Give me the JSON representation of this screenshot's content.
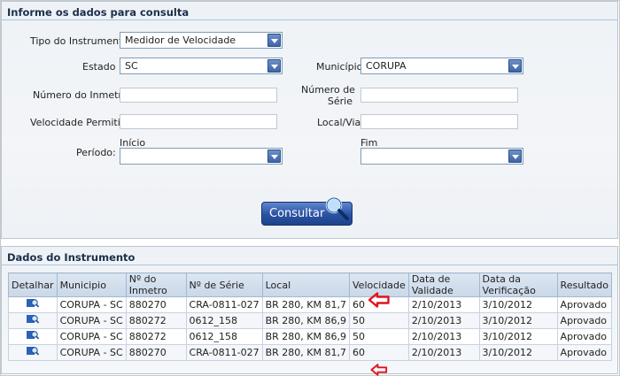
{
  "form": {
    "title": "Informe os dados para consulta",
    "tipo_label": "Tipo do Instrumento",
    "tipo_value": "Medidor de Velocidade",
    "estado_label": "Estado",
    "estado_value": "SC",
    "municipio_label": "Município",
    "municipio_value": "CORUPA",
    "inmetro_label": "Número do Inmetro",
    "inmetro_value": "",
    "serie_label_1": "Número de",
    "serie_label_2": "Série",
    "serie_value": "",
    "velocidade_label": "Velocidade Permitida",
    "velocidade_value": "",
    "local_label": "Local/Via",
    "local_value": "",
    "periodo_label": "Período:",
    "inicio_label": "Início",
    "fim_label": "Fim",
    "inicio_value": "",
    "fim_value": "",
    "consultar_label": "Consultar"
  },
  "results": {
    "title": "Dados do Instrumento",
    "headers": [
      "Detalhar",
      "Municipio",
      "Nº do Inmetro",
      "Nº de Série",
      "Local",
      "Velocidade",
      "Data de Validade",
      "Data da Verificação",
      "Resultado"
    ],
    "rows": [
      [
        "",
        "CORUPA - SC",
        "880270",
        "CRA-0811-027",
        "BR 280, KM 81,7",
        "60",
        "2/10/2013",
        "3/10/2012",
        "Aprovado"
      ],
      [
        "",
        "CORUPA - SC",
        "880272",
        "0612_158",
        "BR 280, KM 86,9",
        "50",
        "2/10/2013",
        "3/10/2012",
        "Aprovado"
      ],
      [
        "",
        "CORUPA - SC",
        "880272",
        "0612_158",
        "BR 280, KM 86,9",
        "50",
        "2/10/2013",
        "3/10/2012",
        "Aprovado"
      ],
      [
        "",
        "CORUPA - SC",
        "880270",
        "CRA-0811-027",
        "BR 280, KM 81,7",
        "60",
        "2/10/2013",
        "3/10/2012",
        "Aprovado"
      ]
    ],
    "detail_icon": "magnifier-detail-icon",
    "annotation_color": "#e0141c"
  }
}
